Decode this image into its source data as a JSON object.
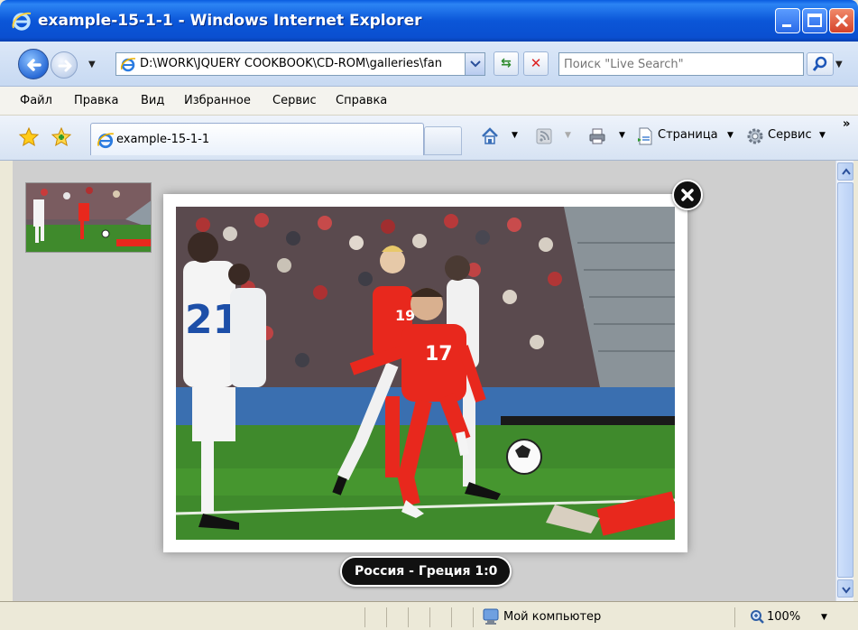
{
  "window": {
    "title": "example-15-1-1 - Windows Internet Explorer"
  },
  "address_bar": {
    "url": "D:\\WORK\\JQUERY COOKBOOK\\CD-ROM\\galleries\\fan",
    "search_placeholder": "Поиск \"Live Search\""
  },
  "menu": {
    "items": [
      "Файл",
      "Правка",
      "Вид",
      "Избранное",
      "Сервис",
      "Справка"
    ]
  },
  "tabs": {
    "active_label": "example-15-1-1"
  },
  "toolbar": {
    "page_label": "Страница",
    "tools_label": "Сервис",
    "more": "»"
  },
  "lightbox": {
    "caption": "Россия - Греция 1:0"
  },
  "status": {
    "zone": "Мой компьютер",
    "zoom": "100%"
  },
  "colors": {
    "titlebar": "#0a56d8",
    "content_bg": "#cfcfcf",
    "pitch": "#3f8a2c",
    "russia_kit": "#e8281d",
    "greece_kit": "#ffffff"
  }
}
